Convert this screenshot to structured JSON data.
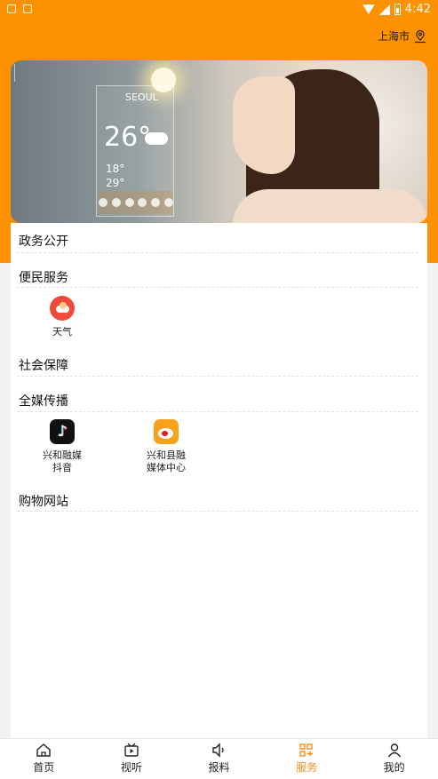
{
  "status_bar": {
    "time": "4:42"
  },
  "header": {
    "location": "上海市"
  },
  "banner": {
    "city": "SEOUL",
    "temperature": "26°",
    "low1": "18°",
    "low2": "29°"
  },
  "sections": {
    "gov": {
      "title": "政务公开"
    },
    "convenience": {
      "title": "便民服务",
      "items": [
        {
          "label": "天气",
          "icon": "weather-icon"
        }
      ]
    },
    "social": {
      "title": "社会保障"
    },
    "media": {
      "title": "全媒传播",
      "items": [
        {
          "label_line1": "兴和融媒",
          "label_line2": "抖音",
          "icon": "tiktok-icon"
        },
        {
          "label_line1": "兴和县融",
          "label_line2": "媒体中心",
          "icon": "weibo-icon"
        }
      ]
    },
    "shopping": {
      "title": "购物网站"
    }
  },
  "tabs": [
    {
      "label": "首页",
      "icon": "home-icon"
    },
    {
      "label": "视听",
      "icon": "video-icon"
    },
    {
      "label": "报料",
      "icon": "report-icon"
    },
    {
      "label": "服务",
      "icon": "service-icon",
      "active": true
    },
    {
      "label": "我的",
      "icon": "profile-icon"
    }
  ],
  "colors": {
    "brand": "#fe9100",
    "active_tab": "#fe8a1c",
    "weather_icon": "#f04a3a",
    "weibo_icon": "#f7a21b"
  }
}
